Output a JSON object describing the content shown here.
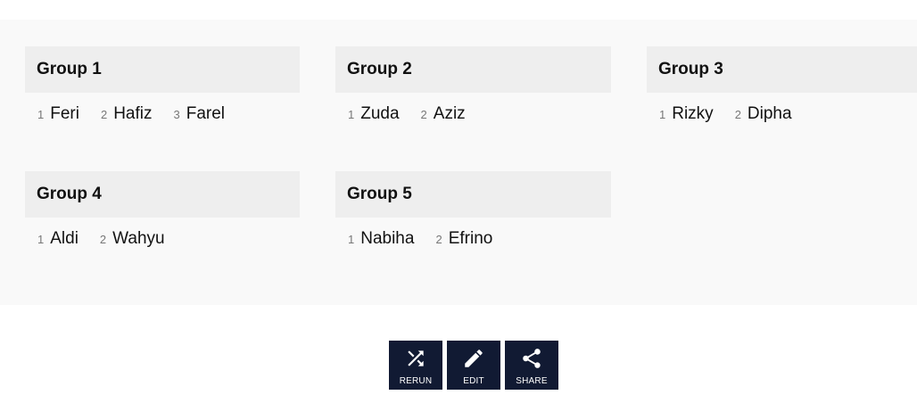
{
  "groups": [
    {
      "title": "Group 1",
      "members": [
        {
          "num": "1",
          "name": "Feri"
        },
        {
          "num": "2",
          "name": "Hafiz"
        },
        {
          "num": "3",
          "name": "Farel"
        }
      ]
    },
    {
      "title": "Group 2",
      "members": [
        {
          "num": "1",
          "name": "Zuda"
        },
        {
          "num": "2",
          "name": "Aziz"
        }
      ]
    },
    {
      "title": "Group 3",
      "members": [
        {
          "num": "1",
          "name": "Rizky"
        },
        {
          "num": "2",
          "name": "Dipha"
        }
      ]
    },
    {
      "title": "Group 4",
      "members": [
        {
          "num": "1",
          "name": "Aldi"
        },
        {
          "num": "2",
          "name": "Wahyu"
        }
      ]
    },
    {
      "title": "Group 5",
      "members": [
        {
          "num": "1",
          "name": "Nabiha"
        },
        {
          "num": "2",
          "name": "Efrino"
        }
      ]
    }
  ],
  "actions": {
    "rerun": {
      "label": "RERUN",
      "icon": "shuffle-icon"
    },
    "edit": {
      "label": "EDIT",
      "icon": "pencil-icon"
    },
    "share": {
      "label": "SHARE",
      "icon": "share-icon"
    }
  },
  "colors": {
    "button_bg": "#111a33",
    "panel_bg": "#f9f9f9",
    "header_bg": "#eeeeee"
  }
}
